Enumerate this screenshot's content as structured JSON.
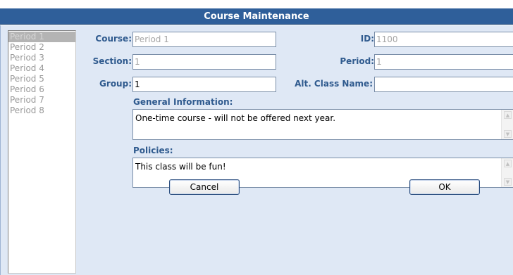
{
  "window": {
    "title": "Course Maintenance"
  },
  "periods": {
    "items": [
      "Period 1",
      "Period 2",
      "Period 3",
      "Period 4",
      "Period 5",
      "Period 6",
      "Period 7",
      "Period 8"
    ],
    "selected_index": 0
  },
  "form": {
    "course_label": "Course:",
    "course_value": "Period 1",
    "id_label": "ID:",
    "id_value": "1100",
    "section_label": "Section:",
    "section_value": "1",
    "period_label": "Period:",
    "period_value": "1",
    "group_label": "Group:",
    "group_value": "1",
    "alt_class_name_label": "Alt. Class Name:",
    "alt_class_name_value": "",
    "general_information_label": "General Information:",
    "general_information_value": "One-time course - will not be offered next year.",
    "policies_label": "Policies:",
    "policies_value": "This class will be fun!"
  },
  "buttons": {
    "cancel_label": "Cancel",
    "ok_label": "OK"
  },
  "colors": {
    "title_bar": "#2f5f9a",
    "label_text": "#2f5a8e",
    "dialog_background": "#dfe8f5"
  }
}
